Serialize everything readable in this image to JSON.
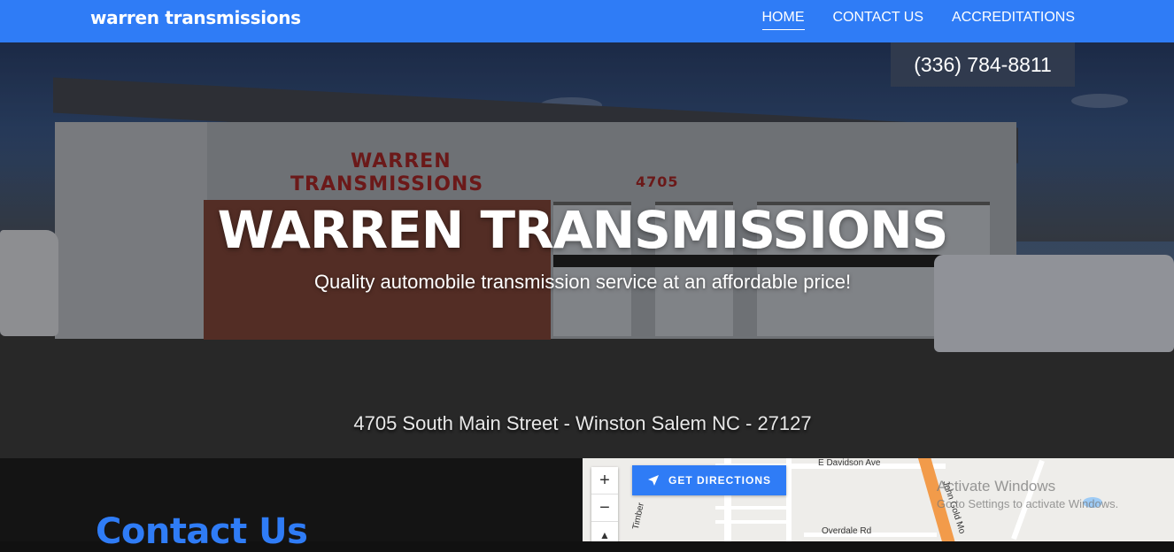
{
  "header": {
    "brand": "warren transmissions",
    "nav": [
      {
        "label": "HOME",
        "active": true
      },
      {
        "label": "CONTACT US",
        "active": false
      },
      {
        "label": "ACCREDITATIONS",
        "active": false
      }
    ],
    "phone": "(336) 784-8811",
    "accent_color": "#2f7cf6"
  },
  "hero": {
    "title": "WARREN TRANSMISSIONS",
    "subtitle": "Quality automobile transmission service at an affordable price!",
    "address": "4705 South Main Street - Winston Salem NC - 27127",
    "sign_line1": "WARREN",
    "sign_line2": "TRANSMISSIONS",
    "building_number": "4705"
  },
  "contact": {
    "title": "Contact Us"
  },
  "map": {
    "zoom_in": "+",
    "zoom_out": "−",
    "directions_label": "GET DIRECTIONS",
    "directions_icon": "navigation-arrow-icon",
    "roads": [
      "E Davidson Ave",
      "Timber",
      "Overdale Rd",
      "John Gold Mo"
    ]
  },
  "system": {
    "watermark_line1": "Activate Windows",
    "watermark_line2": "Go to Settings to activate Windows."
  }
}
